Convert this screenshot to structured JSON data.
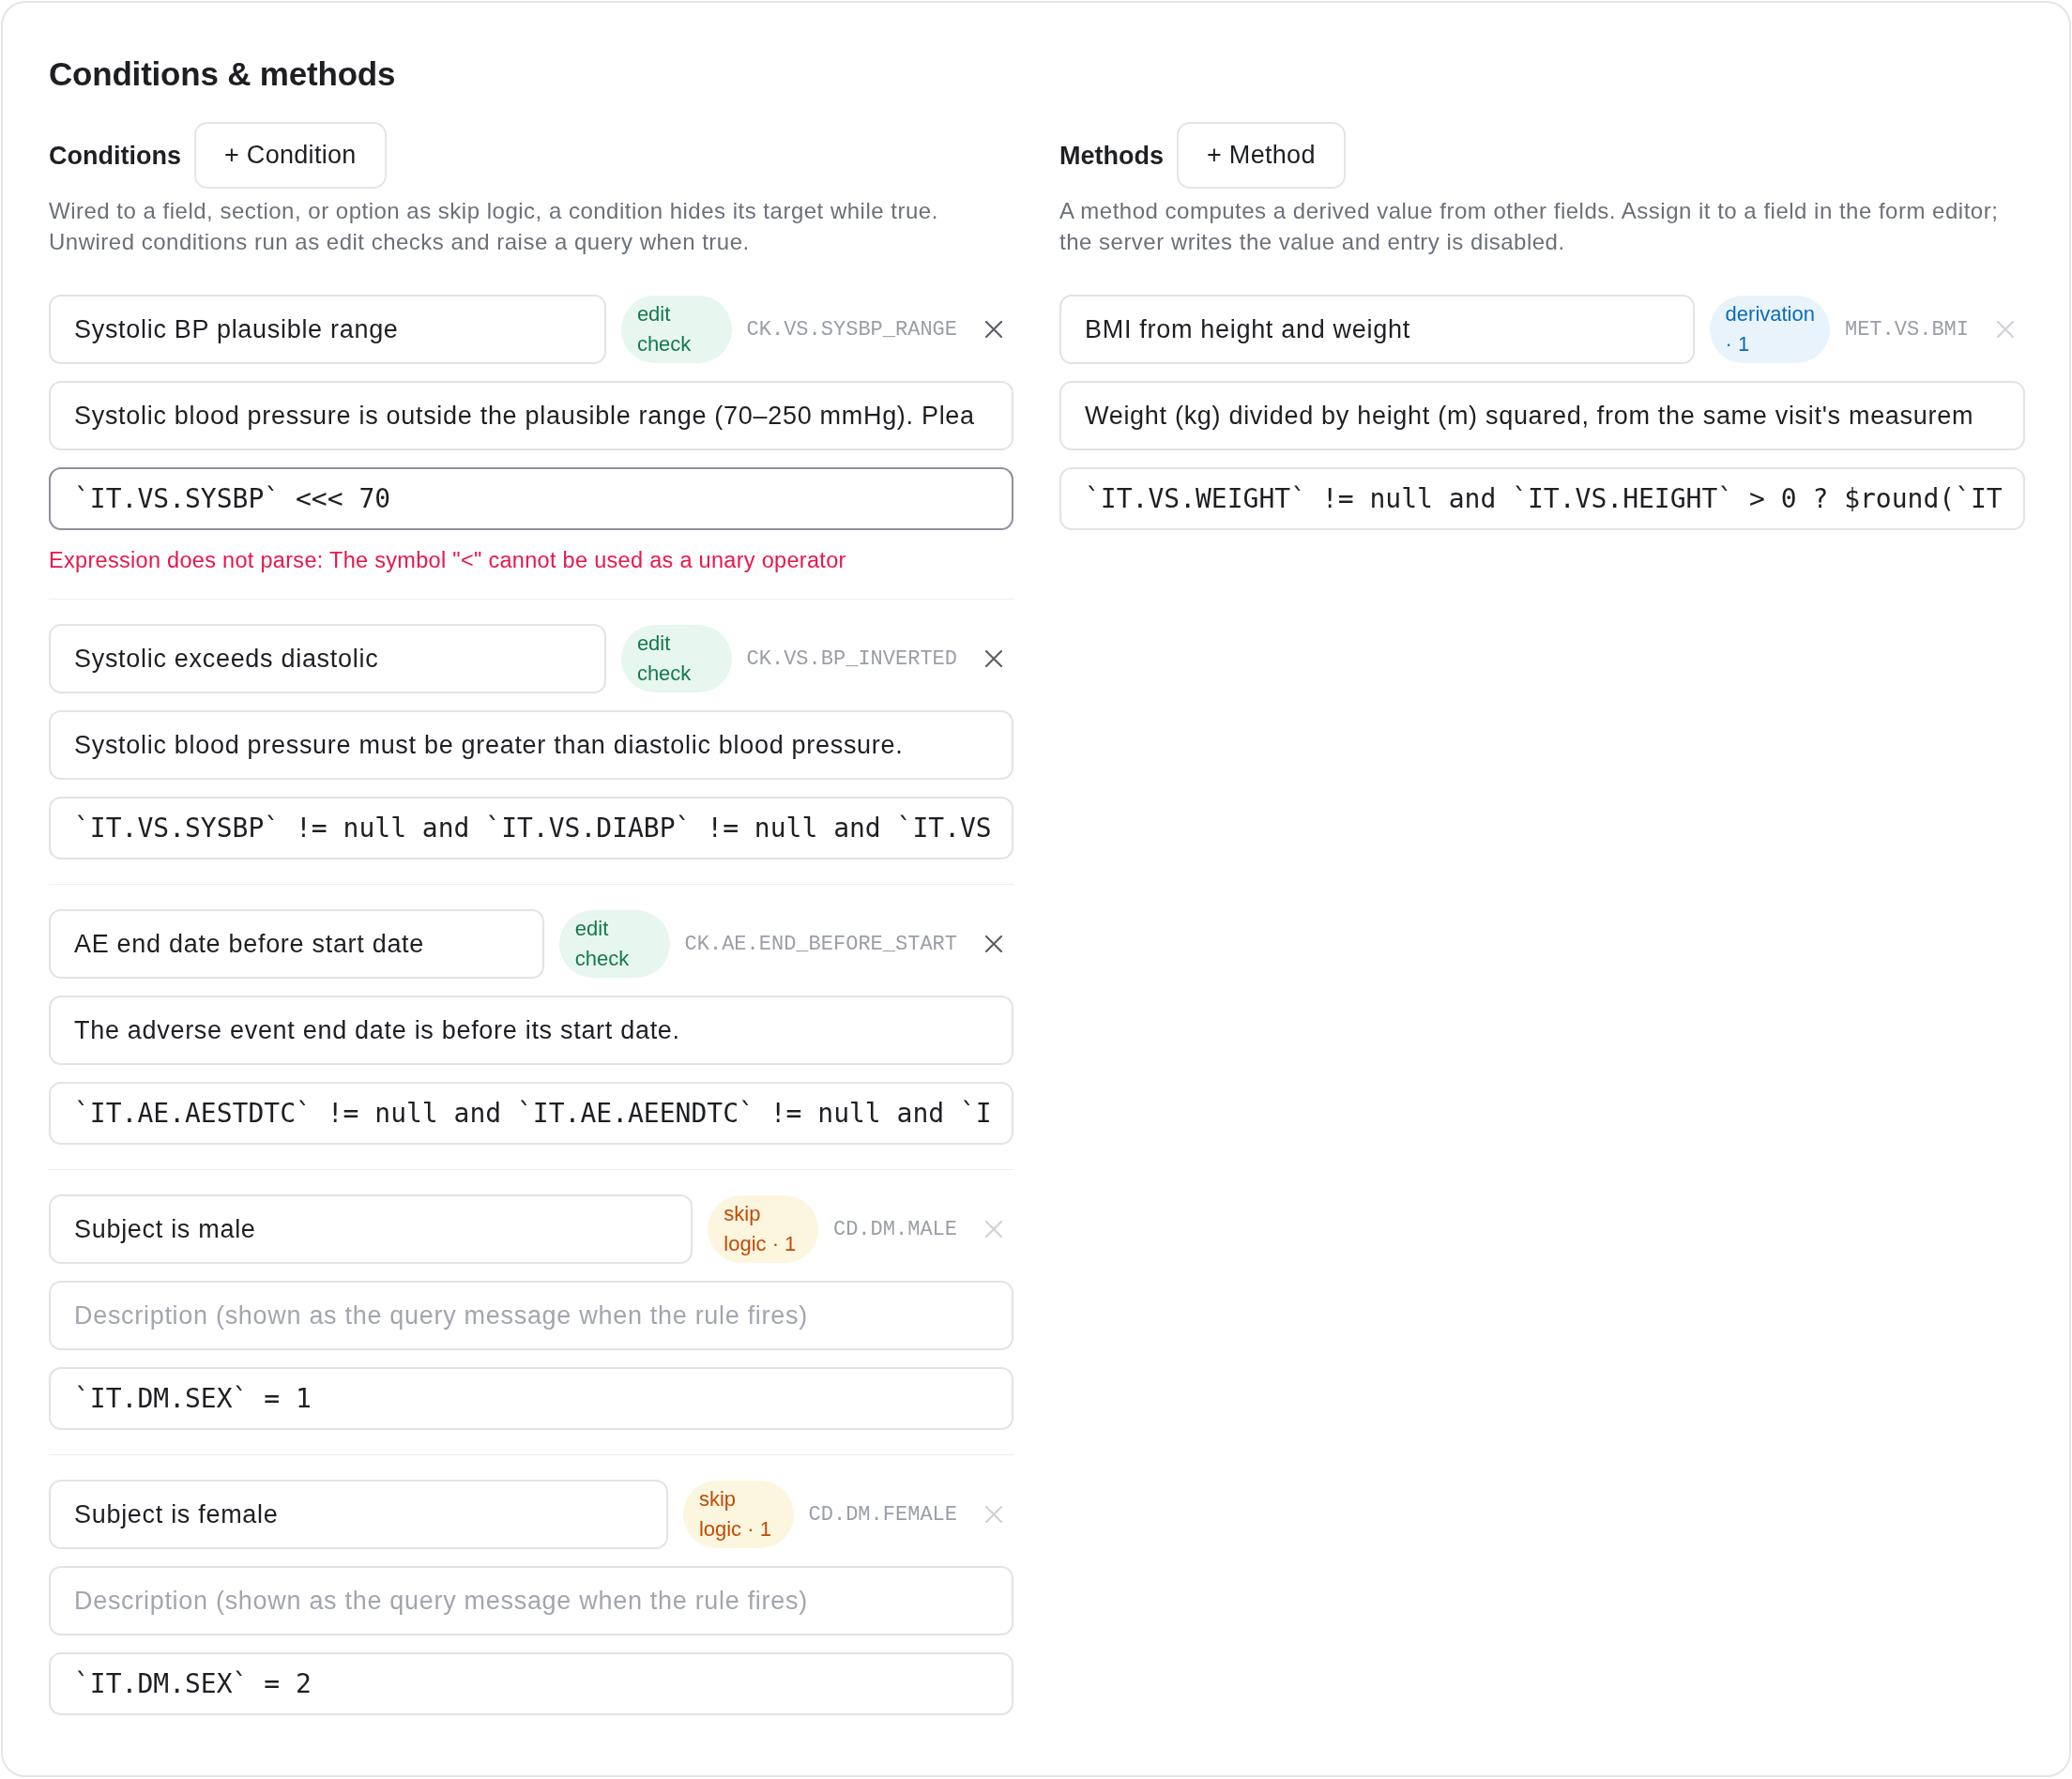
{
  "title": "Conditions & methods",
  "conditions": {
    "heading": "Conditions",
    "add_button": "+ Condition",
    "description": "Wired to a field, section, or option as skip logic, a condition hides its target while true. Unwired conditions run as edit checks and raise a query when true.",
    "items": [
      {
        "name": "Systolic BP plausible range",
        "badge": {
          "kind": "edit_check",
          "label": "edit check"
        },
        "code": "CK.VS.SYSBP_RANGE",
        "removable": true,
        "description": {
          "value": "Systolic blood pressure is outside the plausible range (70–250 mmHg). Plea"
        },
        "expression": "`IT.VS.SYSBP` <<< 70",
        "error": "Expression does not parse: The symbol \"<\" cannot be used as a unary operator"
      },
      {
        "name": "Systolic exceeds diastolic",
        "badge": {
          "kind": "edit_check",
          "label": "edit check"
        },
        "code": "CK.VS.BP_INVERTED",
        "removable": true,
        "description": {
          "value": "Systolic blood pressure must be greater than diastolic blood pressure."
        },
        "expression": "`IT.VS.SYSBP` != null and `IT.VS.DIABP` != null and `IT.VS"
      },
      {
        "name": "AE end date before start date",
        "badge": {
          "kind": "edit_check",
          "label": "edit check"
        },
        "code": "CK.AE.END_BEFORE_START",
        "removable": true,
        "description": {
          "value": "The adverse event end date is before its start date."
        },
        "expression": "`IT.AE.AESTDTC` != null and `IT.AE.AEENDTC` != null and `I"
      },
      {
        "name": "Subject is male",
        "badge": {
          "kind": "skip_logic",
          "label": "skip logic · 1"
        },
        "code": "CD.DM.MALE",
        "removable": false,
        "description": {
          "placeholder": "Description (shown as the query message when the rule fires)"
        },
        "expression": "`IT.DM.SEX` = 1"
      },
      {
        "name": "Subject is female",
        "badge": {
          "kind": "skip_logic",
          "label": "skip logic · 1"
        },
        "code": "CD.DM.FEMALE",
        "removable": false,
        "description": {
          "placeholder": "Description (shown as the query message when the rule fires)"
        },
        "expression": "`IT.DM.SEX` = 2"
      }
    ]
  },
  "methods": {
    "heading": "Methods",
    "add_button": "+ Method",
    "description": "A method computes a derived value from other fields. Assign it to a field in the form editor; the server writes the value and entry is disabled.",
    "items": [
      {
        "name": "BMI from height and weight",
        "badge": {
          "kind": "derivation",
          "label": "derivation · 1"
        },
        "code": "MET.VS.BMI",
        "removable": false,
        "description": {
          "value": "Weight (kg) divided by height (m) squared, from the same visit's measurem"
        },
        "expression": "`IT.VS.WEIGHT` != null and `IT.VS.HEIGHT` > 0 ? $round(`IT"
      }
    ]
  }
}
